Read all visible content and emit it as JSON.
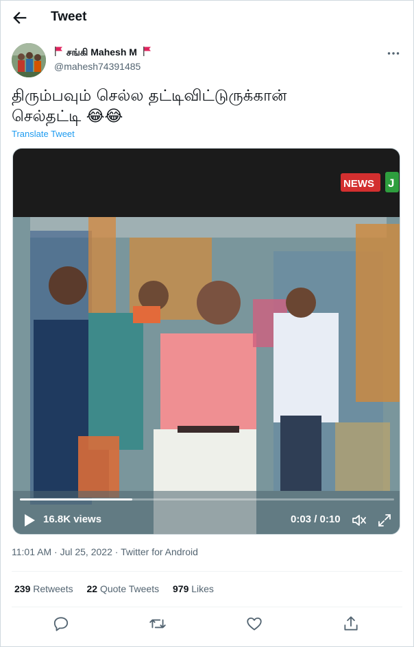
{
  "header": {
    "title": "Tweet"
  },
  "author": {
    "name": "சங்கி Mahesh M",
    "handle": "@mahesh74391485"
  },
  "tweet": {
    "text_line1": "திரும்பவும் செல்ல தட்டிவிட்டுருக்கான்",
    "text_line2": "செல்தட்டி 😂😂",
    "translate_label": "Translate Tweet"
  },
  "video": {
    "views": "16.8K views",
    "timecode": "0:03 / 0:10",
    "progress": 0.3,
    "overlay_logo": "NEWS",
    "overlay_logo_suffix": "J"
  },
  "meta": {
    "time": "11:01 AM",
    "separator1": " · ",
    "date": "Jul 25, 2022",
    "separator2": " · ",
    "source": "Twitter for Android"
  },
  "stats": {
    "retweets_count": "239",
    "retweets_label": "Retweets",
    "quotes_count": "22",
    "quotes_label": "Quote Tweets",
    "likes_count": "979",
    "likes_label": "Likes"
  },
  "colors": {
    "accent": "#1d9bf0",
    "secondary_text": "#536471",
    "divider": "#eff3f4"
  },
  "icons": [
    "back-arrow-icon",
    "flag-icon",
    "more-icon",
    "play-icon",
    "volume-icon",
    "fullscreen-icon",
    "reply-icon",
    "retweet-icon",
    "like-icon",
    "share-icon"
  ]
}
